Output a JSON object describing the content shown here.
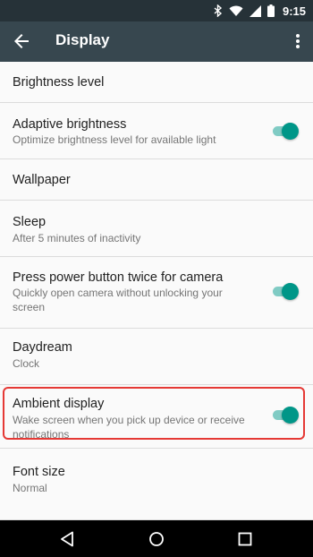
{
  "status_bar": {
    "time": "9:15",
    "icons": [
      "bluetooth-icon",
      "wifi-icon",
      "signal-icon",
      "battery-icon"
    ]
  },
  "app_bar": {
    "title": "Display",
    "back_icon": "arrow-back-icon",
    "menu_icon": "more-vert-icon"
  },
  "settings": [
    {
      "title": "Brightness level",
      "subtitle": ""
    },
    {
      "title": "Adaptive brightness",
      "subtitle": "Optimize brightness level for available light",
      "toggle": true
    },
    {
      "title": "Wallpaper",
      "subtitle": ""
    },
    {
      "title": "Sleep",
      "subtitle": "After 5 minutes of inactivity"
    },
    {
      "title": "Press power button twice for camera",
      "subtitle": "Quickly open camera without unlocking your screen",
      "toggle": true
    },
    {
      "title": "Daydream",
      "subtitle": "Clock"
    },
    {
      "title": "Ambient display",
      "subtitle": "Wake screen when you pick up device or receive notifications",
      "toggle": true,
      "highlighted": true
    },
    {
      "title": "Font size",
      "subtitle": "Normal"
    }
  ],
  "nav_bar": {
    "buttons": [
      "back-triangle-icon",
      "home-circle-icon",
      "recents-square-icon"
    ]
  },
  "colors": {
    "status_bar": "#263238",
    "app_bar": "#37474f",
    "accent": "#009688",
    "accent_track": "#80cbc4",
    "highlight": "#e53935"
  }
}
